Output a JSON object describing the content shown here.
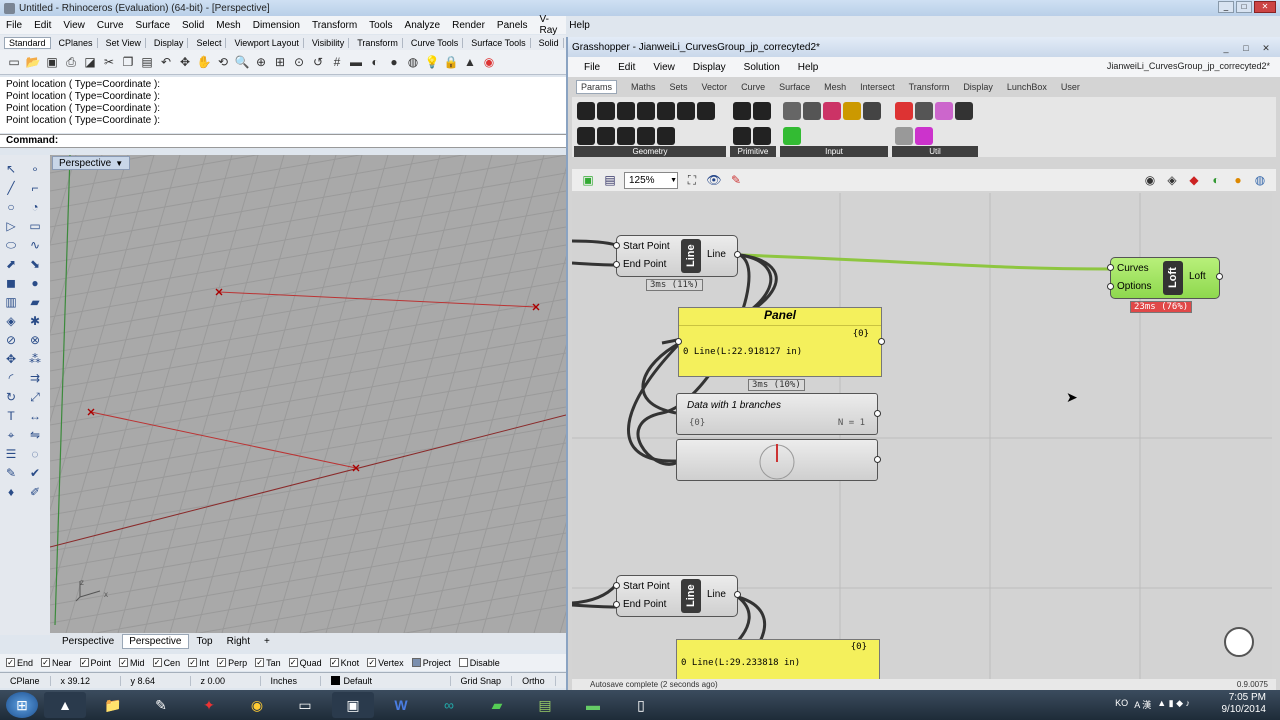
{
  "rhino": {
    "title": "Untitled - Rhinoceros (Evaluation) (64-bit) - [Perspective]",
    "menu": [
      "File",
      "Edit",
      "View",
      "Curve",
      "Surface",
      "Solid",
      "Mesh",
      "Dimension",
      "Transform",
      "Tools",
      "Analyze",
      "Render",
      "Panels",
      "V-Ray",
      "Help"
    ],
    "tabs": [
      "Standard",
      "CPlanes",
      "Set View",
      "Display",
      "Select",
      "Viewport Layout",
      "Visibility",
      "Transform",
      "Curve Tools",
      "Surface Tools",
      "Solid"
    ],
    "history": [
      "Point location ( Type=Coordinate ):",
      "Point location ( Type=Coordinate ):",
      "Point location ( Type=Coordinate ):",
      "Point location ( Type=Coordinate ):"
    ],
    "command_label": "Command:",
    "viewport_label": "Perspective",
    "viewport_tabs": [
      "Perspective",
      "Perspective",
      "Top",
      "Right",
      "+"
    ],
    "osnaps": [
      {
        "label": "End",
        "checked": true
      },
      {
        "label": "Near",
        "checked": true
      },
      {
        "label": "Point",
        "checked": true
      },
      {
        "label": "Mid",
        "checked": true
      },
      {
        "label": "Cen",
        "checked": true
      },
      {
        "label": "Int",
        "checked": true
      },
      {
        "label": "Perp",
        "checked": true
      },
      {
        "label": "Tan",
        "checked": true
      },
      {
        "label": "Quad",
        "checked": true
      },
      {
        "label": "Knot",
        "checked": true
      },
      {
        "label": "Vertex",
        "checked": true
      },
      {
        "label": "Project",
        "checked": false
      },
      {
        "label": "Disable",
        "checked": false
      }
    ],
    "status": {
      "cplane": "CPlane",
      "x": "x 39.12",
      "y": "y 8.64",
      "z": "z 0.00",
      "units": "Inches",
      "layer": "Default",
      "gridsnap": "Grid Snap",
      "ortho": "Ortho"
    }
  },
  "gh": {
    "title": "Grasshopper - JianweiLi_CurvesGroup_jp_correcyted2*",
    "file": "JianweiLi_CurvesGroup_jp_correcyted2*",
    "menu": [
      "File",
      "Edit",
      "View",
      "Display",
      "Solution",
      "Help"
    ],
    "tabs": [
      "Params",
      "Maths",
      "Sets",
      "Vector",
      "Curve",
      "Surface",
      "Mesh",
      "Intersect",
      "Transform",
      "Display",
      "LunchBox",
      "User"
    ],
    "groups": [
      "Geometry",
      "Primitive",
      "Input",
      "Util"
    ],
    "zoom": "125%",
    "line1": {
      "in1": "Start Point",
      "in2": "End Point",
      "name": "Line",
      "out": "Line",
      "time": "3ms (11%)"
    },
    "loft": {
      "in1": "Curves",
      "in2": "Options",
      "name": "Loft",
      "out": "Loft",
      "time": "23ms (76%)"
    },
    "panel1": {
      "title": "Panel",
      "path": "{0}",
      "row": "0 Line(L:22.918127 in)",
      "time": "3ms (10%)"
    },
    "data": {
      "title": "Data with 1 branches",
      "path": "{0}",
      "count": "N = 1"
    },
    "line2": {
      "in1": "Start Point",
      "in2": "End Point",
      "name": "Line",
      "out": "Line"
    },
    "panel2": {
      "path": "{0}",
      "row": "0 Line(L:29.233818 in)"
    },
    "status": "Autosave complete (2 seconds ago)",
    "version": "0.9.0075"
  },
  "taskbar": {
    "lang": "KO",
    "ime": "A 漢",
    "time": "7:05 PM",
    "date": "9/10/2014"
  }
}
